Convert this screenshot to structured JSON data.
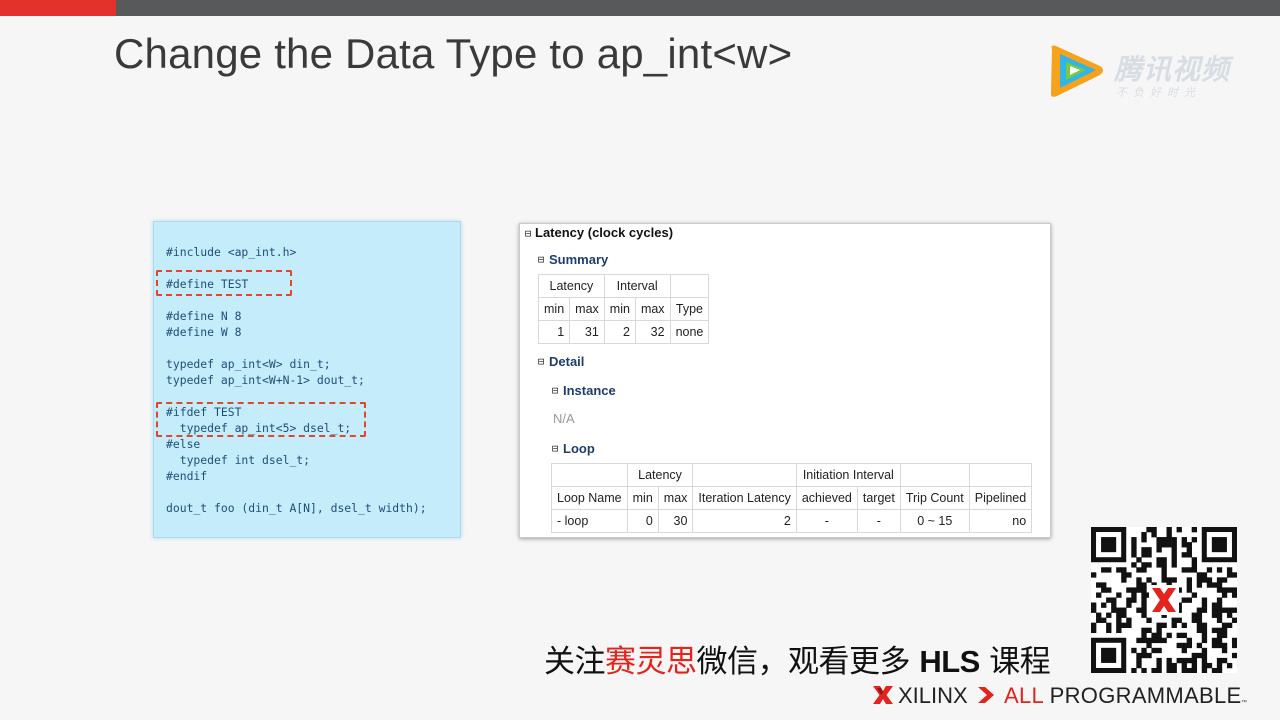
{
  "slide": {
    "title": "Change the Data Type to ap_int<w>"
  },
  "watermark": {
    "brand": "腾讯视频",
    "slogan": "不负好时光",
    "logo_icon": "play-triangle-icon"
  },
  "code": {
    "lines": [
      "#include <ap_int.h>",
      "",
      "#define TEST",
      "",
      "#define N 8",
      "#define W 8",
      "",
      "typedef ap_int<W> din_t;",
      "typedef ap_int<W+N-1> dout_t;",
      "",
      "#ifdef TEST",
      "  typedef ap_int<5> dsel_t;",
      "#else",
      "  typedef int dsel_t;",
      "#endif",
      "",
      "dout_t foo (din_t A[N], dsel_t width);"
    ]
  },
  "report": {
    "latency_title": "Latency (clock cycles)",
    "summary_title": "Summary",
    "summary": {
      "group_latency": "Latency",
      "group_interval": "Interval",
      "headers": [
        "min",
        "max",
        "min",
        "max",
        "Type"
      ],
      "row": [
        "1",
        "31",
        "2",
        "32",
        "none"
      ]
    },
    "detail_title": "Detail",
    "instance_title": "Instance",
    "instance_value": "N/A",
    "loop_title": "Loop",
    "loop": {
      "group_latency": "Latency",
      "group_ii": "Initiation Interval",
      "headers": [
        "Loop Name",
        "min",
        "max",
        "Iteration Latency",
        "achieved",
        "target",
        "Trip Count",
        "Pipelined"
      ],
      "row": [
        "- loop",
        "0",
        "30",
        "2",
        "-",
        "-",
        "0 ~ 15",
        "no"
      ]
    },
    "collapse_symbol": "⊟"
  },
  "footer": {
    "follow_prefix": "关注",
    "follow_brand": "赛灵思",
    "follow_mid": "微信，观看更多 ",
    "follow_hls": "HLS",
    "follow_suffix": " 课程",
    "xilinx": "XILINX",
    "all_prefix": "ALL",
    "programmable": " PROGRAMMABLE",
    "tm": "™"
  },
  "colors": {
    "accent_red": "#e3322b",
    "code_bg": "#c4ecfb",
    "code_text": "#1f4e79",
    "highlight_dash": "#e0462a",
    "report_section": "#1f3d6d"
  }
}
